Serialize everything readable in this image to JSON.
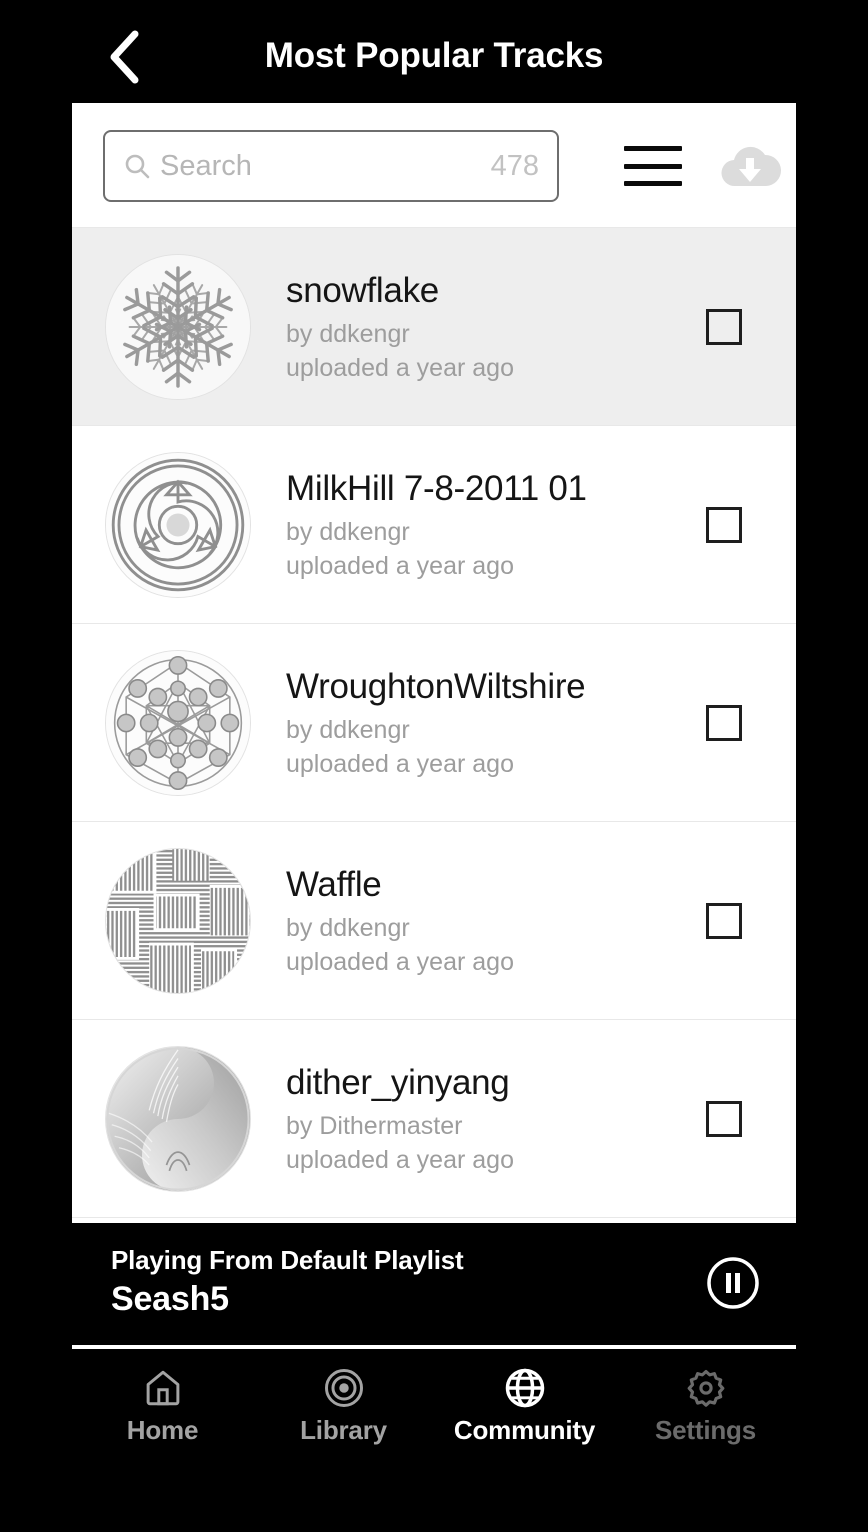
{
  "header": {
    "title": "Most Popular Tracks",
    "back_icon": "chevron-left-icon"
  },
  "search": {
    "placeholder": "Search",
    "value": "",
    "count": "478",
    "search_icon": "search-icon",
    "menu_icon": "hamburger-menu-icon",
    "download_icon": "cloud-download-icon"
  },
  "tracks": [
    {
      "title": "snowflake",
      "by": "by ddkengr",
      "uploaded": "uploaded a year ago",
      "selected": true,
      "checked": false,
      "thumb": "snowflake-fractal-thumbnail"
    },
    {
      "title": "MilkHill 7-8-2011 01",
      "by": "by ddkengr",
      "uploaded": "uploaded a year ago",
      "selected": false,
      "checked": false,
      "thumb": "triskelion-cropcircle-thumbnail"
    },
    {
      "title": "WroughtonWiltshire",
      "by": "by ddkengr",
      "uploaded": "uploaded a year ago",
      "selected": false,
      "checked": false,
      "thumb": "node-network-thumbnail"
    },
    {
      "title": "Waffle",
      "by": "by ddkengr",
      "uploaded": "uploaded a year ago",
      "selected": false,
      "checked": false,
      "thumb": "hatched-maze-thumbnail"
    },
    {
      "title": "dither_yinyang",
      "by": "by Dithermaster",
      "uploaded": "uploaded a year ago",
      "selected": false,
      "checked": false,
      "thumb": "dither-yinyang-thumbnail"
    }
  ],
  "player": {
    "source": "Playing From Default Playlist",
    "track": "Seash5",
    "button_icon": "pause-circle-icon",
    "state": "playing"
  },
  "bottom_nav": {
    "items": [
      {
        "label": "Home",
        "icon": "home-icon",
        "active": false,
        "dim": false
      },
      {
        "label": "Library",
        "icon": "target-icon",
        "active": false,
        "dim": false
      },
      {
        "label": "Community",
        "icon": "globe-icon",
        "active": true,
        "dim": false
      },
      {
        "label": "Settings",
        "icon": "gear-icon",
        "active": false,
        "dim": true
      }
    ]
  },
  "colors": {
    "background": "#000000",
    "card": "#ffffff",
    "selected_row": "#eeeeee",
    "title_text": "#151515",
    "muted_text": "#9d9d9d",
    "accent_white": "#ffffff"
  }
}
